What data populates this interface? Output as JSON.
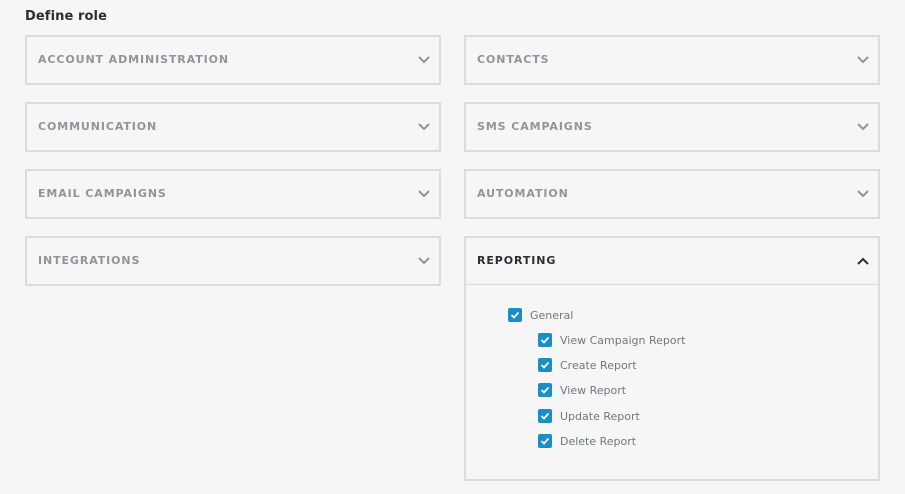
{
  "page": {
    "title": "Define role"
  },
  "sections": [
    {
      "label": "ACCOUNT ADMINISTRATION",
      "expanded": false
    },
    {
      "label": "CONTACTS",
      "expanded": false
    },
    {
      "label": "COMMUNICATION",
      "expanded": false
    },
    {
      "label": "SMS CAMPAIGNS",
      "expanded": false
    },
    {
      "label": "EMAIL CAMPAIGNS",
      "expanded": false
    },
    {
      "label": "AUTOMATION",
      "expanded": false
    },
    {
      "label": "INTEGRATIONS",
      "expanded": false
    },
    {
      "label": "REPORTING",
      "expanded": true
    }
  ],
  "reporting": {
    "general": {
      "label": "General",
      "checked": true
    },
    "permissions": [
      {
        "label": "View Campaign Report",
        "checked": true
      },
      {
        "label": "Create Report",
        "checked": true
      },
      {
        "label": "View Report",
        "checked": true
      },
      {
        "label": "Update Report",
        "checked": true
      },
      {
        "label": "Delete Report",
        "checked": true
      }
    ]
  },
  "icons": {
    "collapsed": "chevron-down-icon",
    "expanded": "chevron-up-icon",
    "checkbox": "checkmark-icon"
  },
  "colors": {
    "accent": "#1a8ec9",
    "border": "#dcdcdc",
    "background": "#f6f6f6",
    "label_muted": "#8e959c",
    "label_active": "#2a2f36"
  }
}
